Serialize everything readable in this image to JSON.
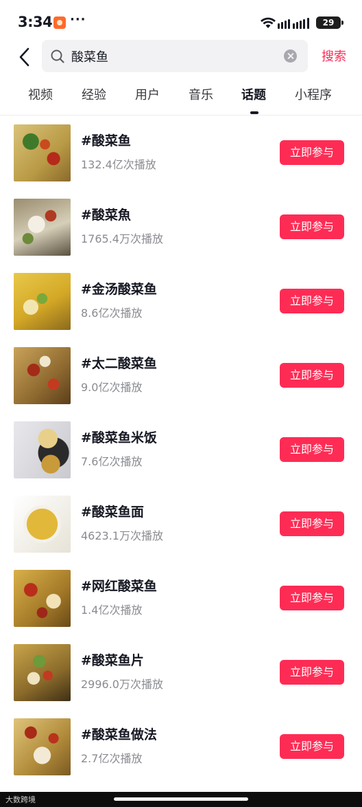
{
  "status_bar": {
    "time": "3:34",
    "more": "···",
    "battery": "29"
  },
  "search": {
    "query": "酸菜鱼",
    "submit_label": "搜索"
  },
  "tabs": [
    {
      "label": "视频",
      "active": false
    },
    {
      "label": "经验",
      "active": false
    },
    {
      "label": "用户",
      "active": false
    },
    {
      "label": "音乐",
      "active": false
    },
    {
      "label": "话题",
      "active": true
    },
    {
      "label": "小程序",
      "active": false
    }
  ],
  "topics": [
    {
      "title": "#酸菜鱼",
      "count": "132.4亿次播放",
      "button": "立即参与"
    },
    {
      "title": "#酸菜魚",
      "count": "1765.4万次播放",
      "button": "立即参与"
    },
    {
      "title": "#金汤酸菜鱼",
      "count": "8.6亿次播放",
      "button": "立即参与"
    },
    {
      "title": "#太二酸菜鱼",
      "count": "9.0亿次播放",
      "button": "立即参与"
    },
    {
      "title": "#酸菜鱼米饭",
      "count": "7.6亿次播放",
      "button": "立即参与"
    },
    {
      "title": "#酸菜鱼面",
      "count": "4623.1万次播放",
      "button": "立即参与"
    },
    {
      "title": "#网红酸菜鱼",
      "count": "1.4亿次播放",
      "button": "立即参与"
    },
    {
      "title": "#酸菜鱼片",
      "count": "2996.0万次播放",
      "button": "立即参与"
    },
    {
      "title": "#酸菜鱼做法",
      "count": "2.7亿次播放",
      "button": "立即参与"
    }
  ],
  "watermark": "大数跨境",
  "colors": {
    "accent": "#fe2c55",
    "text": "#161823",
    "muted": "#8a8b91"
  }
}
